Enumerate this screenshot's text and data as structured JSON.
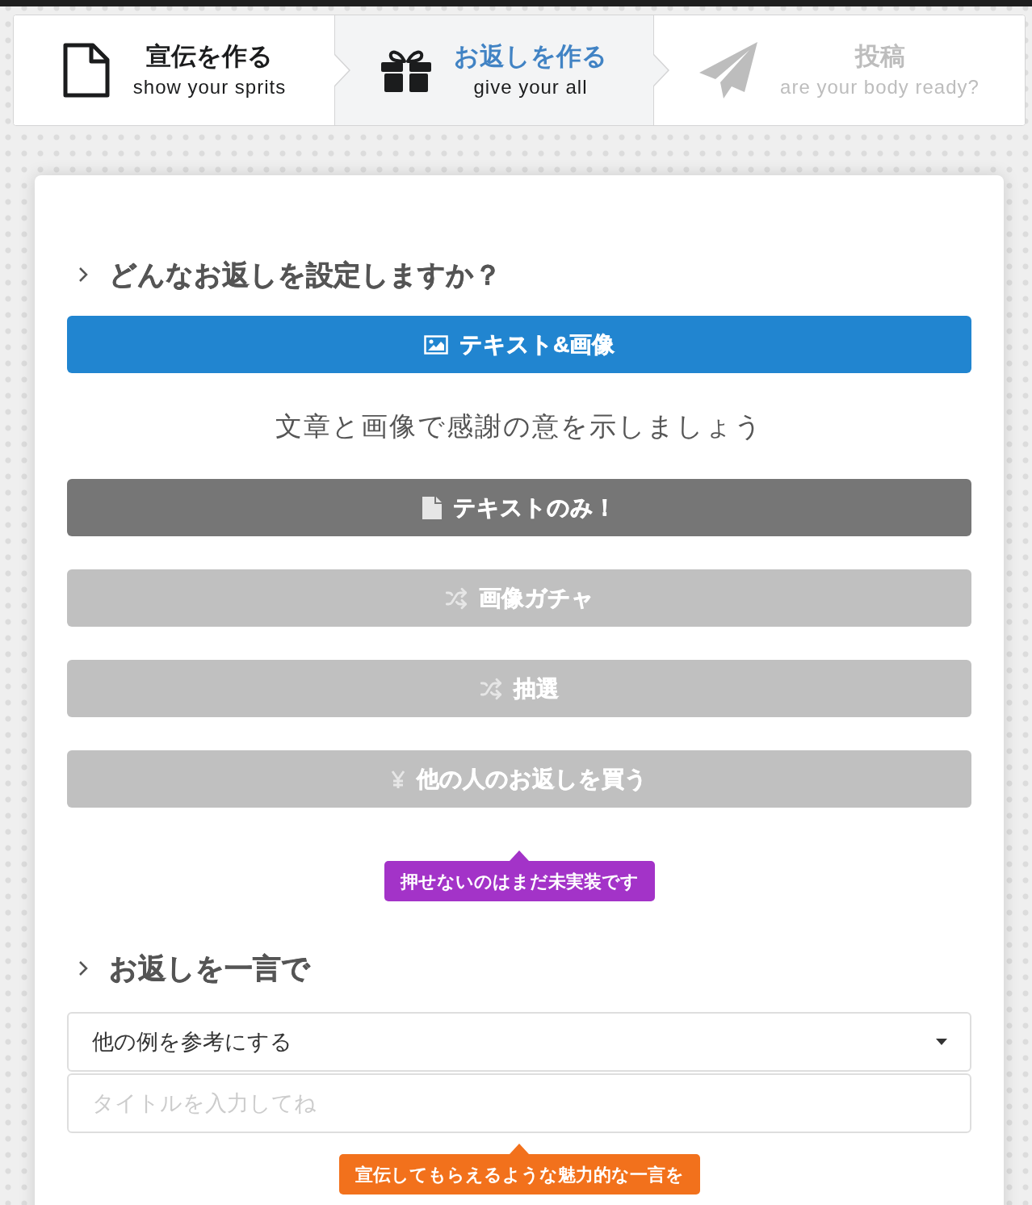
{
  "steps": [
    {
      "title": "宣伝を作る",
      "subtitle": "show your sprits",
      "selected": false,
      "disabled": false
    },
    {
      "title": "お返しを作る",
      "subtitle": "give your all",
      "selected": true,
      "disabled": false
    },
    {
      "title": "投稿",
      "subtitle": "are your body ready?",
      "selected": false,
      "disabled": true
    }
  ],
  "reward_type": {
    "heading": "どんなお返しを設定しますか？",
    "options": [
      {
        "label": "テキスト&画像",
        "selected": true,
        "disabled": false
      },
      {
        "label": "テキストのみ！",
        "selected": false,
        "disabled": false
      },
      {
        "label": "画像ガチャ",
        "selected": false,
        "disabled": true
      },
      {
        "label": "抽選",
        "selected": false,
        "disabled": true
      },
      {
        "label": "他の人のお返しを買う",
        "selected": false,
        "disabled": true
      }
    ],
    "description": "文章と画像で感謝の意を示しましょう",
    "note": "押せないのはまだ未実装です"
  },
  "one_liner": {
    "heading": "お返しを一言で",
    "dropdown": {
      "value": "他の例を参考にする"
    },
    "title_field": {
      "placeholder": "タイトルを入力してね"
    },
    "hint": "宣伝してもらえるような魅力的な一言を"
  }
}
